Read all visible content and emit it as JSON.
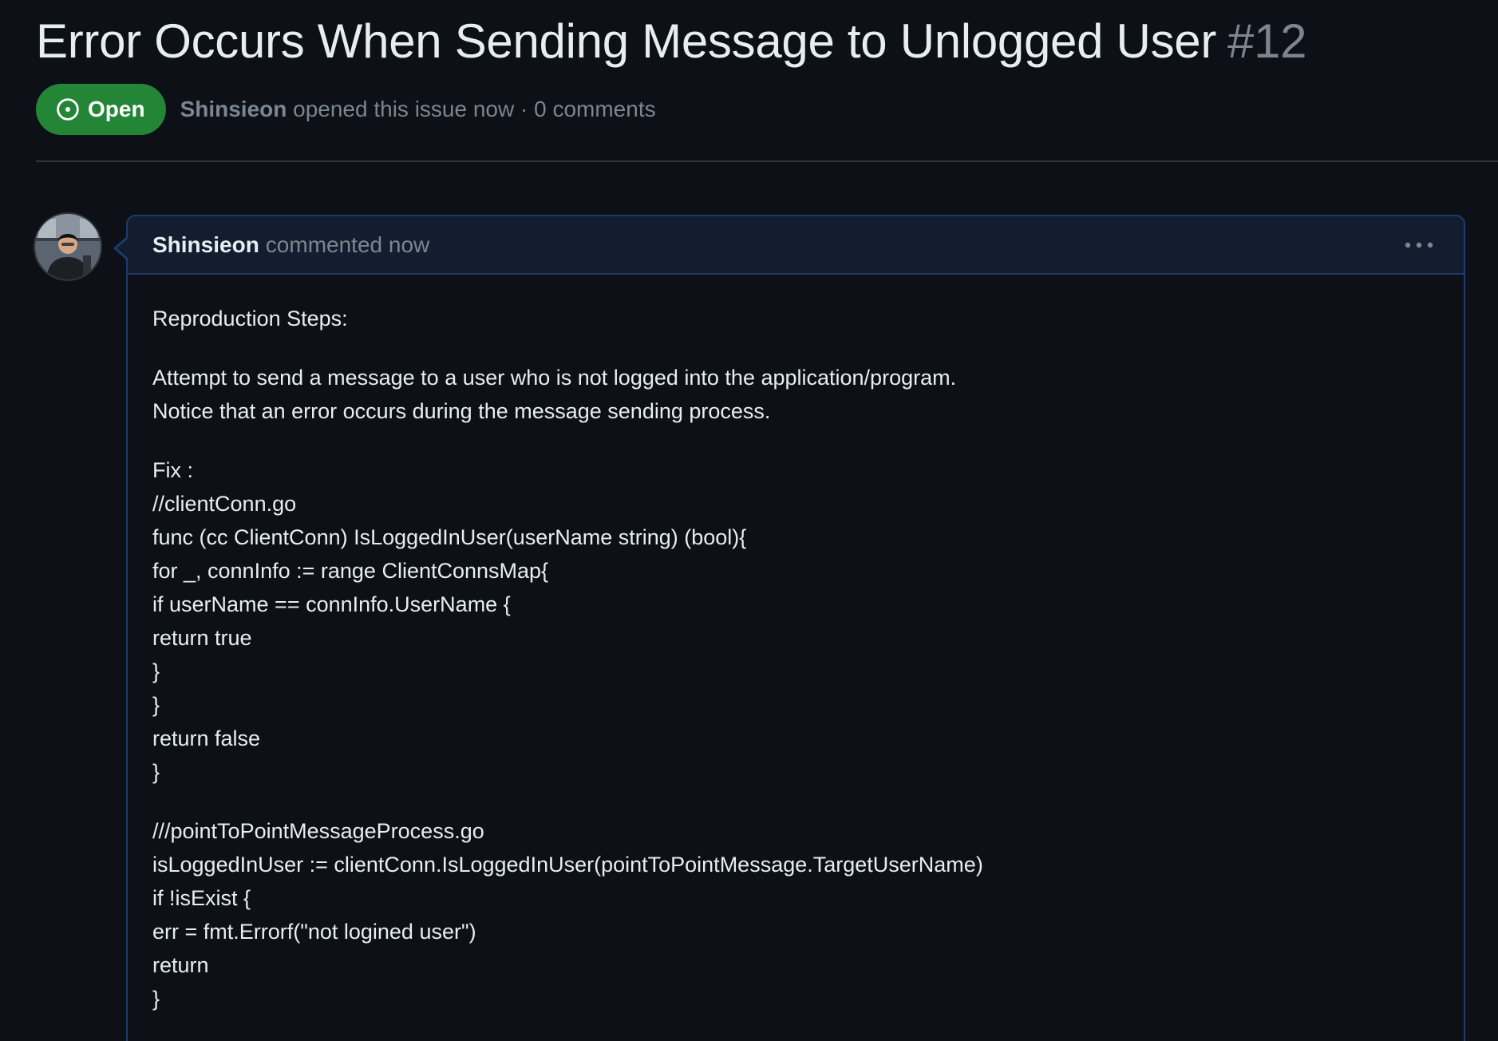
{
  "issue": {
    "title": "Error Occurs When Sending Message to Unlogged User",
    "number": "#12",
    "state": "Open",
    "author": "Shinsieon",
    "meta": "opened this issue now · 0 comments"
  },
  "comment": {
    "author": "Shinsieon",
    "timestamp": "commented now",
    "menu_icon": "kebab-horizontal-icon",
    "paragraphs": [
      [
        "Reproduction Steps:"
      ],
      [
        "Attempt to send a message to a user who is not logged into the application/program.",
        "Notice that an error occurs during the message sending process."
      ],
      [
        "Fix :",
        "//clientConn.go",
        "func (cc ClientConn) IsLoggedInUser(userName string) (bool){",
        "for _, connInfo := range ClientConnsMap{",
        "if userName == connInfo.UserName {",
        "return true",
        "}",
        "}",
        "return false",
        "}"
      ],
      [
        "///pointToPointMessageProcess.go",
        "isLoggedInUser := clientConn.IsLoggedInUser(pointToPointMessage.TargetUserName)",
        "if !isExist {",
        "err = fmt.Errorf(\"not logined user\")",
        "return",
        "}"
      ]
    ]
  },
  "colors": {
    "background": "#0d1117",
    "open_badge": "#238636",
    "muted_text": "#7d8590",
    "comment_border": "#1f3b6e",
    "comment_header_bg": "#121d2f"
  }
}
